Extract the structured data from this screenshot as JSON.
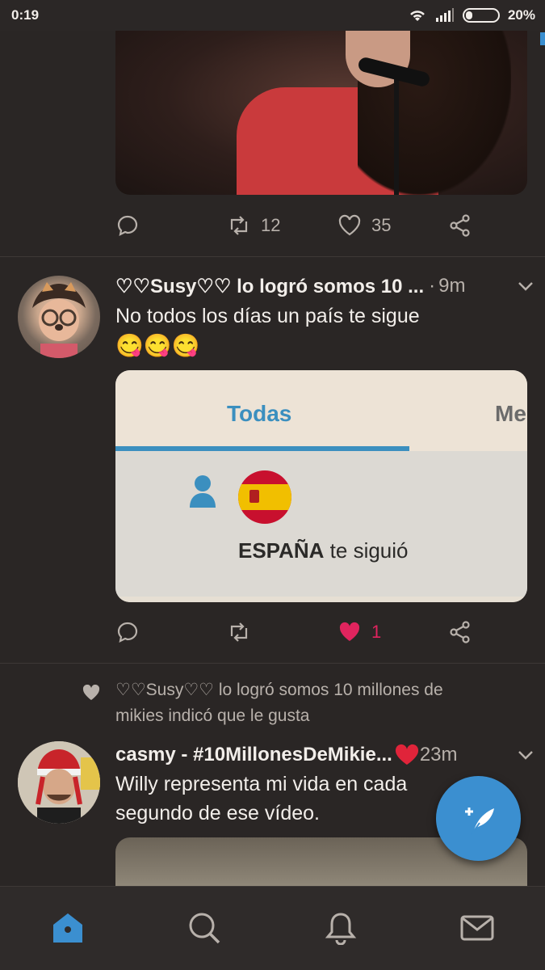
{
  "status_bar": {
    "time": "0:19",
    "battery": "20%"
  },
  "tweets": [
    {
      "actions": {
        "retweets": "12",
        "likes": "35"
      }
    },
    {
      "author": "♡♡Susy♡♡ lo logró somos 10 ...",
      "separator": "·",
      "time": "9m",
      "text": "No todos los días un país te sigue",
      "emoji": "😋😋😋",
      "card": {
        "tab_active": "Todas",
        "tab_next": "Me",
        "notification_name": "ESPAÑA",
        "notification_suffix": " te siguió"
      },
      "actions": {
        "retweets": "",
        "likes": "1"
      }
    },
    {
      "liked_by_text": "♡♡Susy♡♡ lo logró somos 10 millones de mikies indicó que le gusta",
      "author": "casmy - #10MillonesDeMikie...",
      "time": "23m",
      "text": "Willy representa mi vida en cada segundo de ese vídeo."
    }
  ],
  "icons": {
    "reply": "reply-icon",
    "retweet": "retweet-icon",
    "like": "heart-icon",
    "share": "share-icon",
    "compose": "compose-feather-icon",
    "home": "home-icon",
    "search": "search-icon",
    "notifications": "bell-icon",
    "messages": "mail-icon"
  },
  "colors": {
    "accent": "#3b8fd0",
    "like_active": "#e0245e",
    "background": "#2a2625"
  }
}
